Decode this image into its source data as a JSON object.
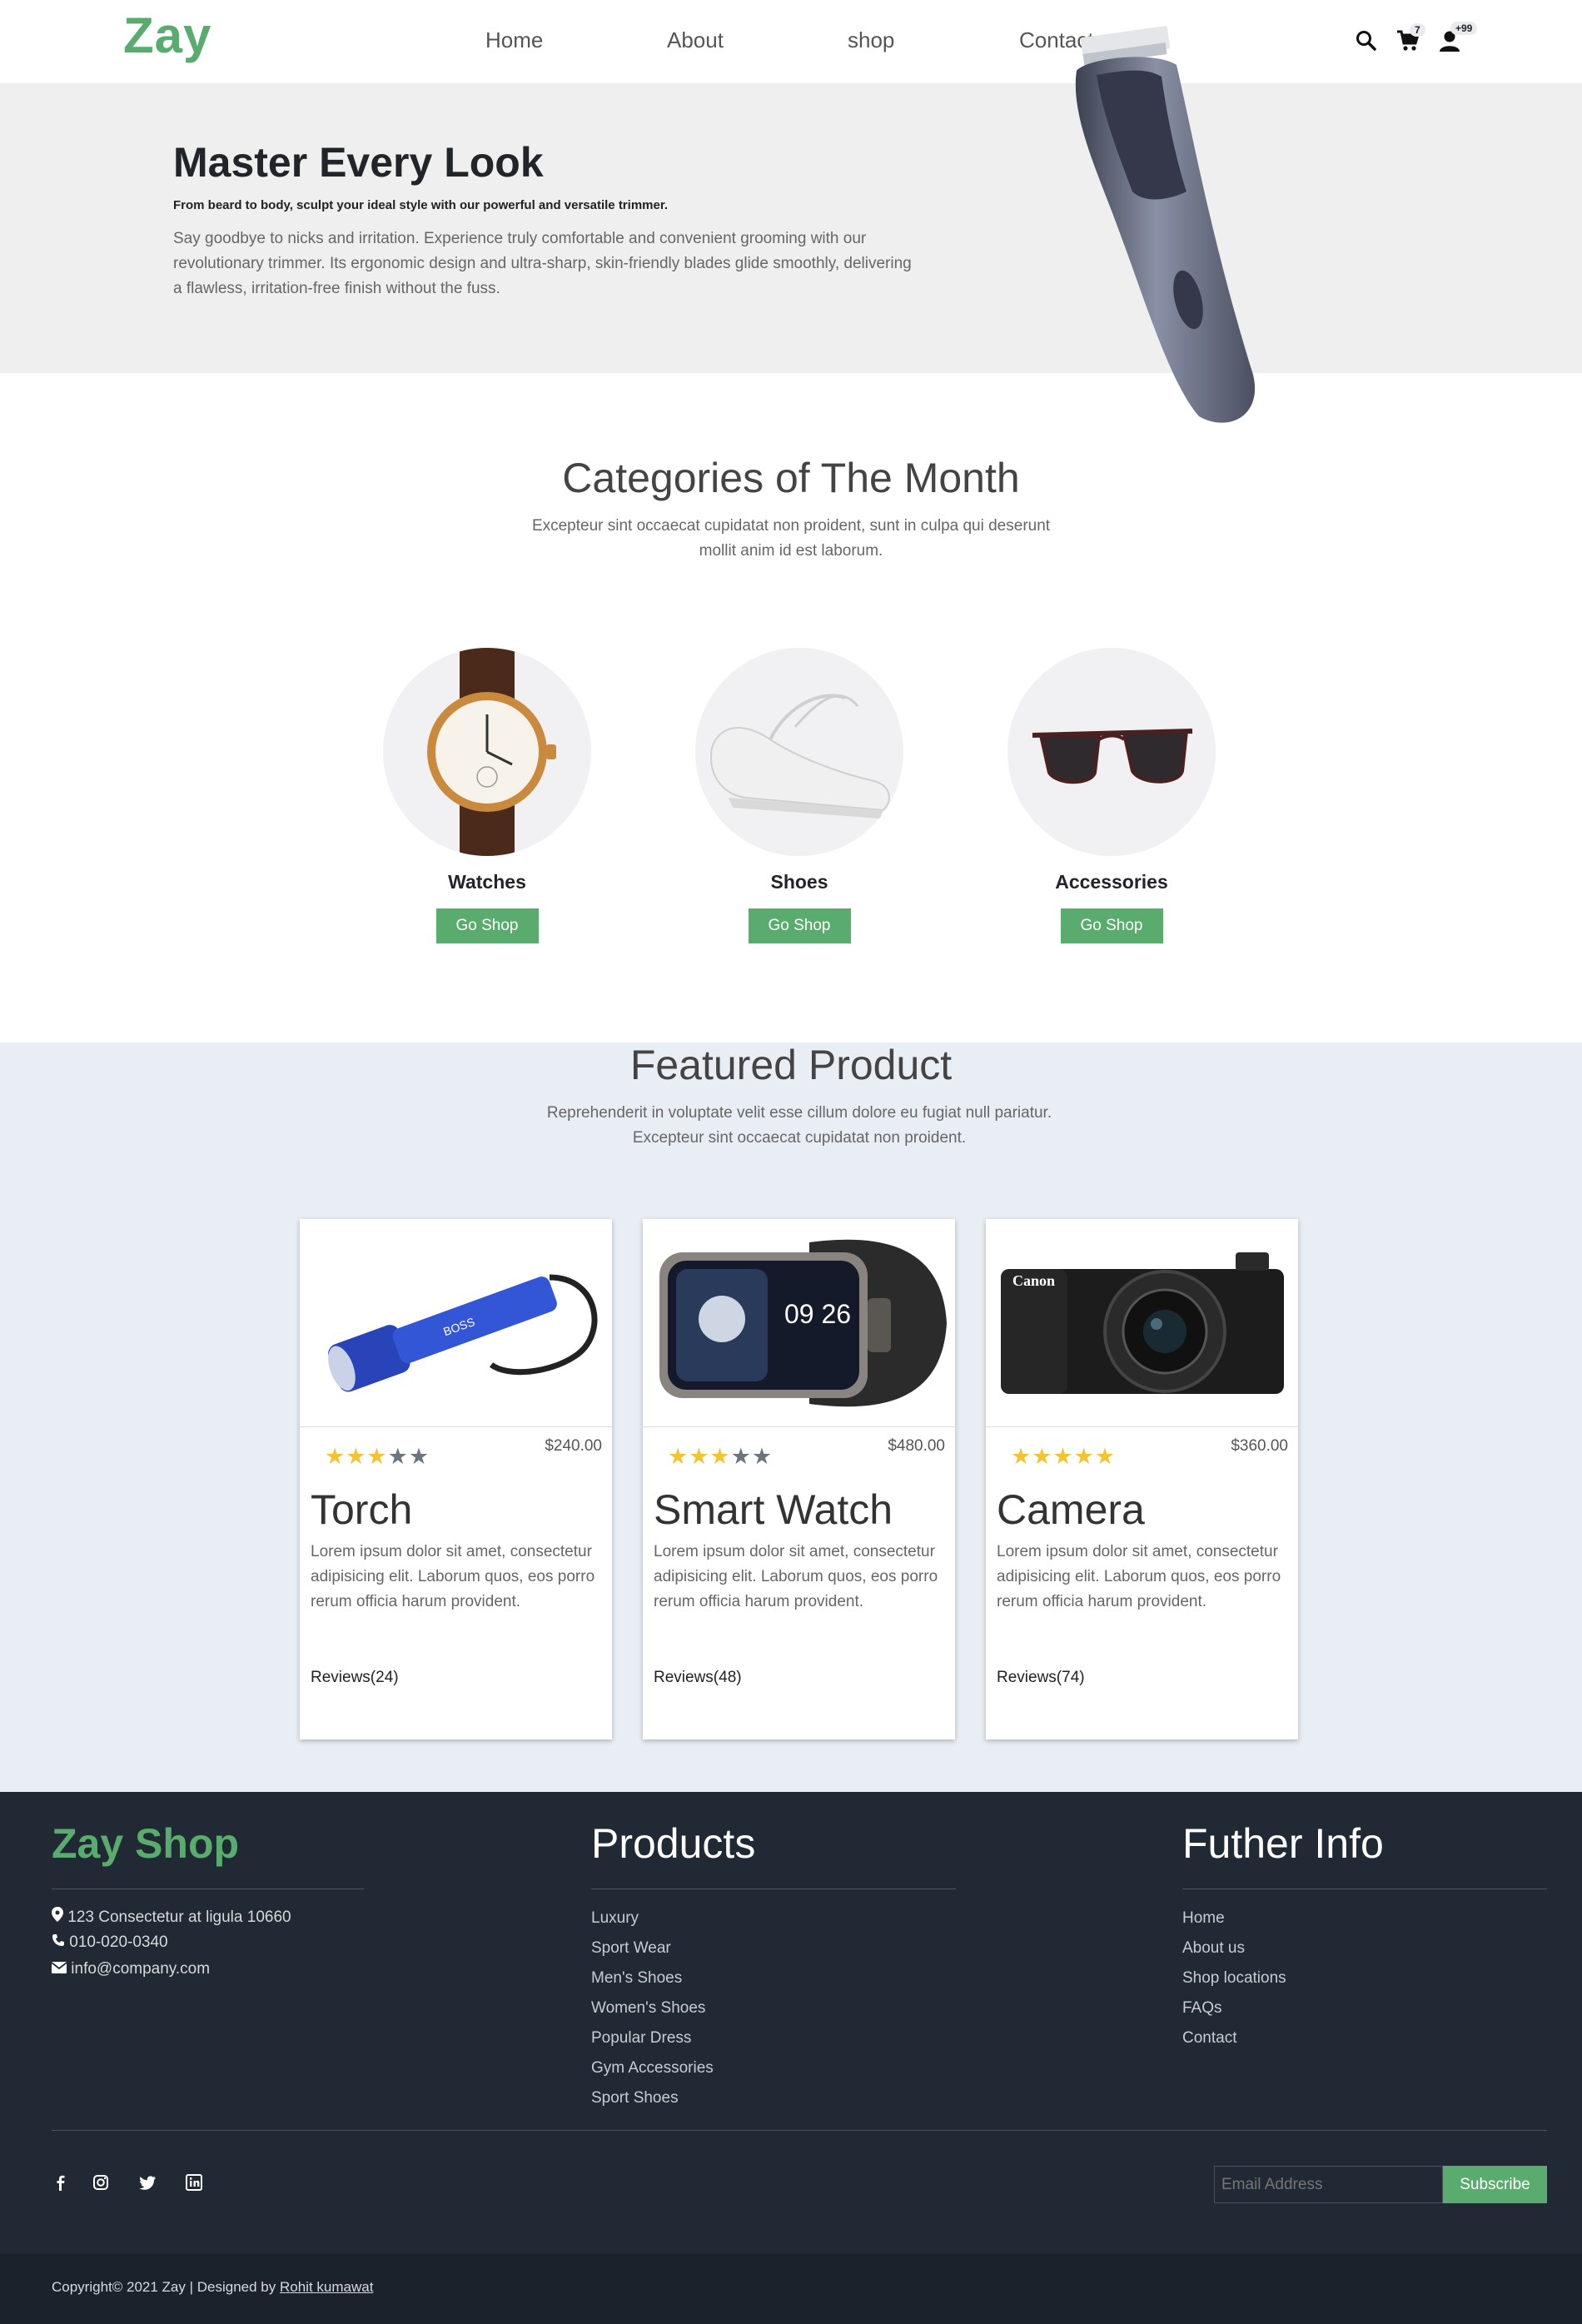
{
  "nav": {
    "logo": "Zay",
    "links": [
      "Home",
      "About",
      "shop",
      "Contact"
    ],
    "cart_badge": "7",
    "user_badge": "+99"
  },
  "hero": {
    "title": "Master Every Look",
    "subtitle": "From beard to body, sculpt your ideal style with our powerful and versatile trimmer.",
    "text": "Say goodbye to nicks and irritation. Experience truly comfortable and convenient grooming with our revolutionary trimmer. Its ergonomic design and ultra-sharp, skin-friendly blades glide smoothly, delivering a flawless, irritation-free finish without the fuss."
  },
  "categories": {
    "title": "Categories of The Month",
    "subtitle": "Excepteur sint occaecat cupidatat non proident, sunt in culpa qui deserunt mollit anim id est laborum.",
    "items": [
      {
        "name": "Watches",
        "button": "Go Shop"
      },
      {
        "name": "Shoes",
        "button": "Go Shop"
      },
      {
        "name": "Accessories",
        "button": "Go Shop"
      }
    ]
  },
  "featured": {
    "title": "Featured Product",
    "subtitle": "Reprehenderit in voluptate velit esse cillum dolore eu fugiat null pariatur. Excepteur sint occaecat cupidatat non proident.",
    "products": [
      {
        "name": "Torch",
        "price": "$240.00",
        "rating": 3,
        "desc": "Lorem ipsum dolor sit amet, consectetur adipisicing elit. Laborum quos, eos porro rerum officia harum provident.",
        "reviews": "Reviews(24)",
        "image_text": "BOSS"
      },
      {
        "name": "Smart Watch",
        "price": "$480.00",
        "rating": 3,
        "desc": "Lorem ipsum dolor sit amet, consectetur adipisicing elit. Laborum quos, eos porro rerum officia harum provident.",
        "reviews": "Reviews(48)",
        "image_text": "09 26"
      },
      {
        "name": "Camera",
        "price": "$360.00",
        "rating": 5,
        "desc": "Lorem ipsum dolor sit amet, consectetur adipisicing elit. Laborum quos, eos porro rerum officia harum provident.",
        "reviews": "Reviews(74)",
        "image_text": "Canon"
      }
    ]
  },
  "footer": {
    "brand": "Zay Shop",
    "address": "123 Consectetur at ligula 10660",
    "phone": "010-020-0340",
    "email": "info@company.com",
    "products_title": "Products",
    "products": [
      "Luxury",
      "Sport Wear",
      "Men's Shoes",
      "Women's Shoes",
      "Popular Dress",
      "Gym Accessories",
      "Sport Shoes"
    ],
    "info_title": "Futher Info",
    "info": [
      "Home",
      "About us",
      "Shop locations",
      "FAQs",
      "Contact"
    ],
    "email_placeholder": "Email Address",
    "subscribe": "Subscribe",
    "copyright": "Copyright© 2021 Zay | Designed by",
    "designer": "Rohit kumawat"
  },
  "colors": {
    "brand": "#59ab6e",
    "footer_bg": "#212934",
    "featured_bg": "#e9eef5"
  }
}
